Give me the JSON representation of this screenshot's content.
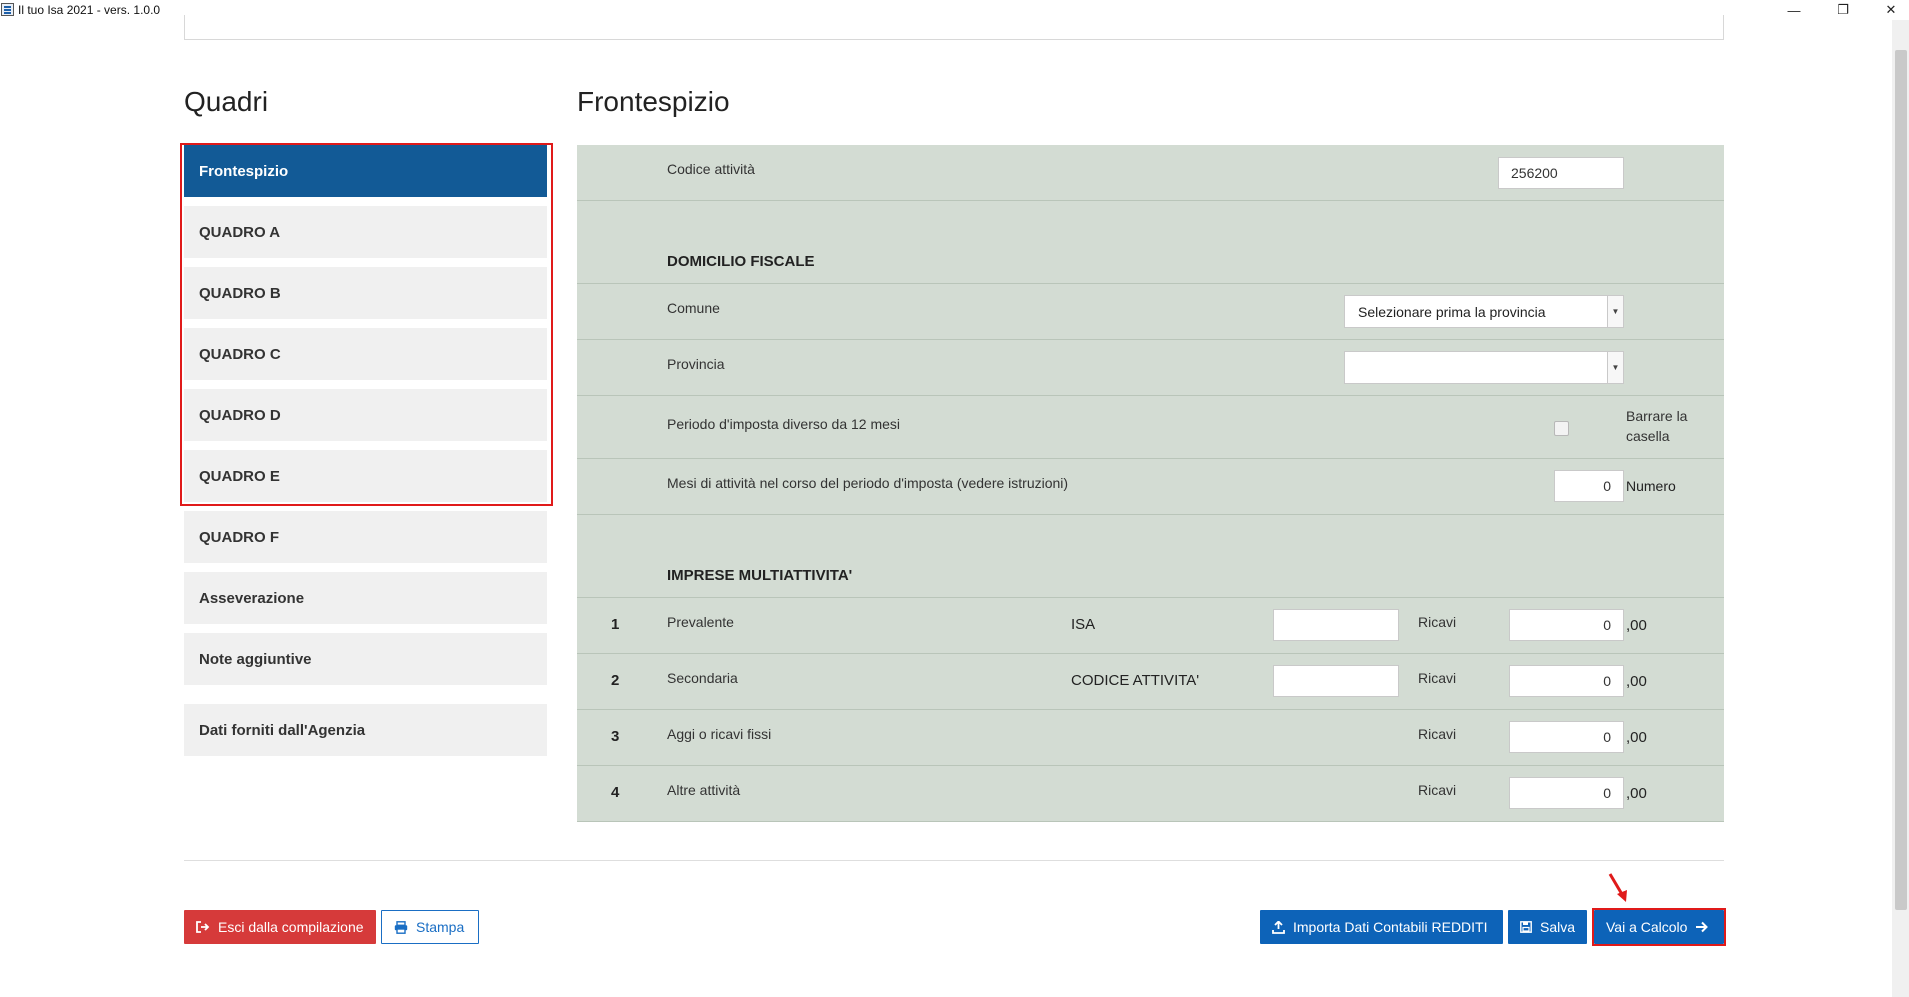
{
  "window": {
    "title": "Il tuo Isa 2021 - vers. 1.0.0",
    "minimize": "—",
    "restore": "❐",
    "close": "✕"
  },
  "sidebar": {
    "title": "Quadri",
    "items": [
      {
        "label": "Frontespizio",
        "active": true
      },
      {
        "label": "QUADRO A"
      },
      {
        "label": "QUADRO B"
      },
      {
        "label": "QUADRO C"
      },
      {
        "label": "QUADRO D"
      },
      {
        "label": "QUADRO E"
      },
      {
        "label": "QUADRO F"
      },
      {
        "label": "Asseverazione"
      },
      {
        "label": "Note aggiuntive"
      },
      {
        "label": "Dati forniti dall'Agenzia"
      }
    ]
  },
  "main": {
    "title": "Frontespizio",
    "codice_attivita": {
      "label": "Codice attività",
      "value": "256200"
    },
    "domicilio_heading": "DOMICILIO FISCALE",
    "comune": {
      "label": "Comune",
      "value": "Selezionare prima la provincia"
    },
    "provincia": {
      "label": "Provincia",
      "value": ""
    },
    "periodo": {
      "label": "Periodo d'imposta diverso da 12 mesi",
      "hint": "Barrare la casella",
      "checked": false
    },
    "mesi": {
      "label": "Mesi di attività nel corso del periodo d'imposta (vedere istruzioni)",
      "value": "0",
      "unit": "Numero"
    },
    "multi_heading": "IMPRESE MULTIATTIVITA'",
    "multi_rows": [
      {
        "num": "1",
        "label": "Prevalente",
        "code_label": "ISA",
        "code_value": "",
        "ricavi_label": "Ricavi",
        "ricavi_value": "0",
        "suffix": ",00"
      },
      {
        "num": "2",
        "label": "Secondaria",
        "code_label": "CODICE ATTIVITA'",
        "code_value": "",
        "ricavi_label": "Ricavi",
        "ricavi_value": "0",
        "suffix": ",00"
      },
      {
        "num": "3",
        "label": "Aggi o ricavi fissi",
        "ricavi_label": "Ricavi",
        "ricavi_value": "0",
        "suffix": ",00"
      },
      {
        "num": "4",
        "label": "Altre attività",
        "ricavi_label": "Ricavi",
        "ricavi_value": "0",
        "suffix": ",00"
      }
    ]
  },
  "footer": {
    "exit_label": "Esci dalla compilazione",
    "print_label": "Stampa",
    "import_label": "Importa Dati Contabili REDDITI",
    "save_label": "Salva",
    "calc_label": "Vai a Calcolo"
  },
  "colors": {
    "accent": "#125a96",
    "primary_button": "#0d63b8",
    "danger_button": "#d63a3a",
    "form_background": "#d3dcd3",
    "highlight": "#e01a1a"
  }
}
